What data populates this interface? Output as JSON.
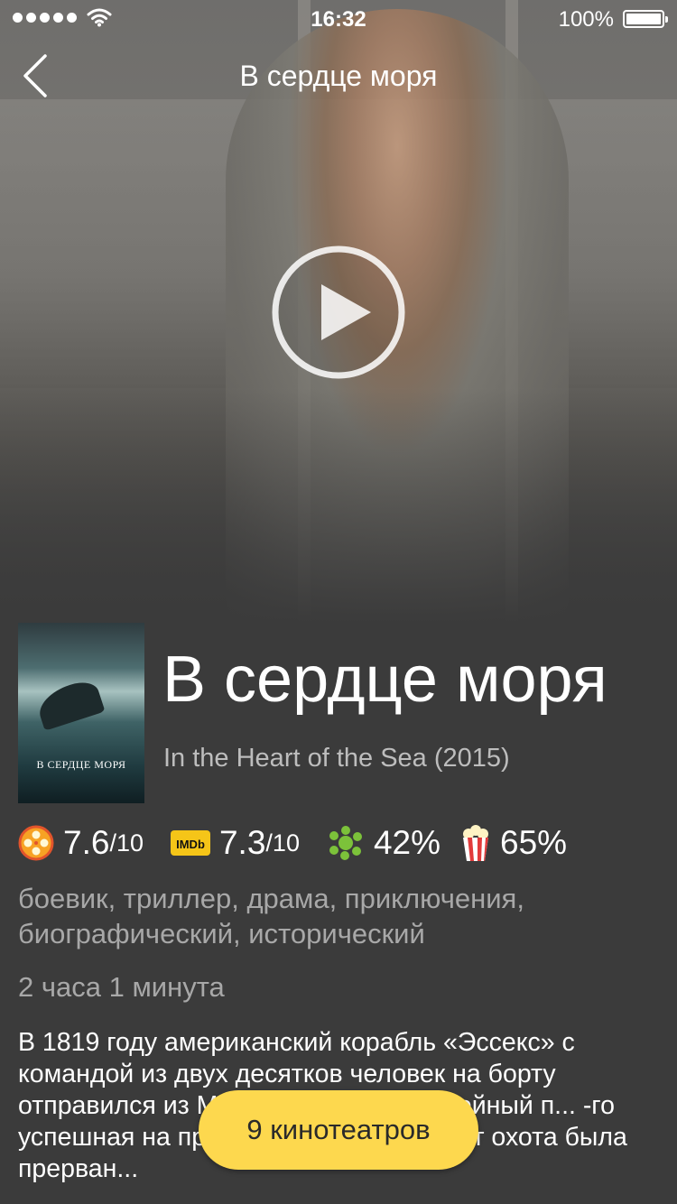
{
  "status_bar": {
    "time": "16:32",
    "battery": "100%",
    "signal_dots": 5,
    "icons": [
      "signal-icon",
      "wifi-icon",
      "battery-icon"
    ]
  },
  "nav": {
    "title": "В сердце моря",
    "back_icon": "chevron-left-icon"
  },
  "hero": {
    "play_icon": "play-icon"
  },
  "poster": {
    "title": "В СЕРДЦЕ МОРЯ"
  },
  "movie": {
    "title": "В сердце моря",
    "original_title": "In the Heart of the Sea (2015)",
    "genres": "боевик, триллер, драма, приключения, биографический, исторический",
    "duration": "2 часа 1 минута",
    "description": "В 1819 году американский корабль «Эссекс» с командой из двух десятков человек на борту отправился из Массачусетс на китобойный п... -го успешная на протяжении полутора лет охота была прерван..."
  },
  "ratings": [
    {
      "source": "kinopoisk",
      "icon": "film-reel-icon",
      "value": "7.6",
      "denominator": "/10"
    },
    {
      "source": "imdb",
      "icon": "imdb-icon",
      "value": "7.3",
      "denominator": "/10"
    },
    {
      "source": "rotten-tomatoes-critics",
      "icon": "splat-icon",
      "value": "42%",
      "denominator": ""
    },
    {
      "source": "rotten-tomatoes-audience",
      "icon": "popcorn-icon",
      "value": "65%",
      "denominator": ""
    }
  ],
  "cta": {
    "label": "9 кинотеатров"
  },
  "colors": {
    "background": "#3b3b3b",
    "accent": "#fdd84e",
    "secondary_text": "#a8a8a8"
  }
}
